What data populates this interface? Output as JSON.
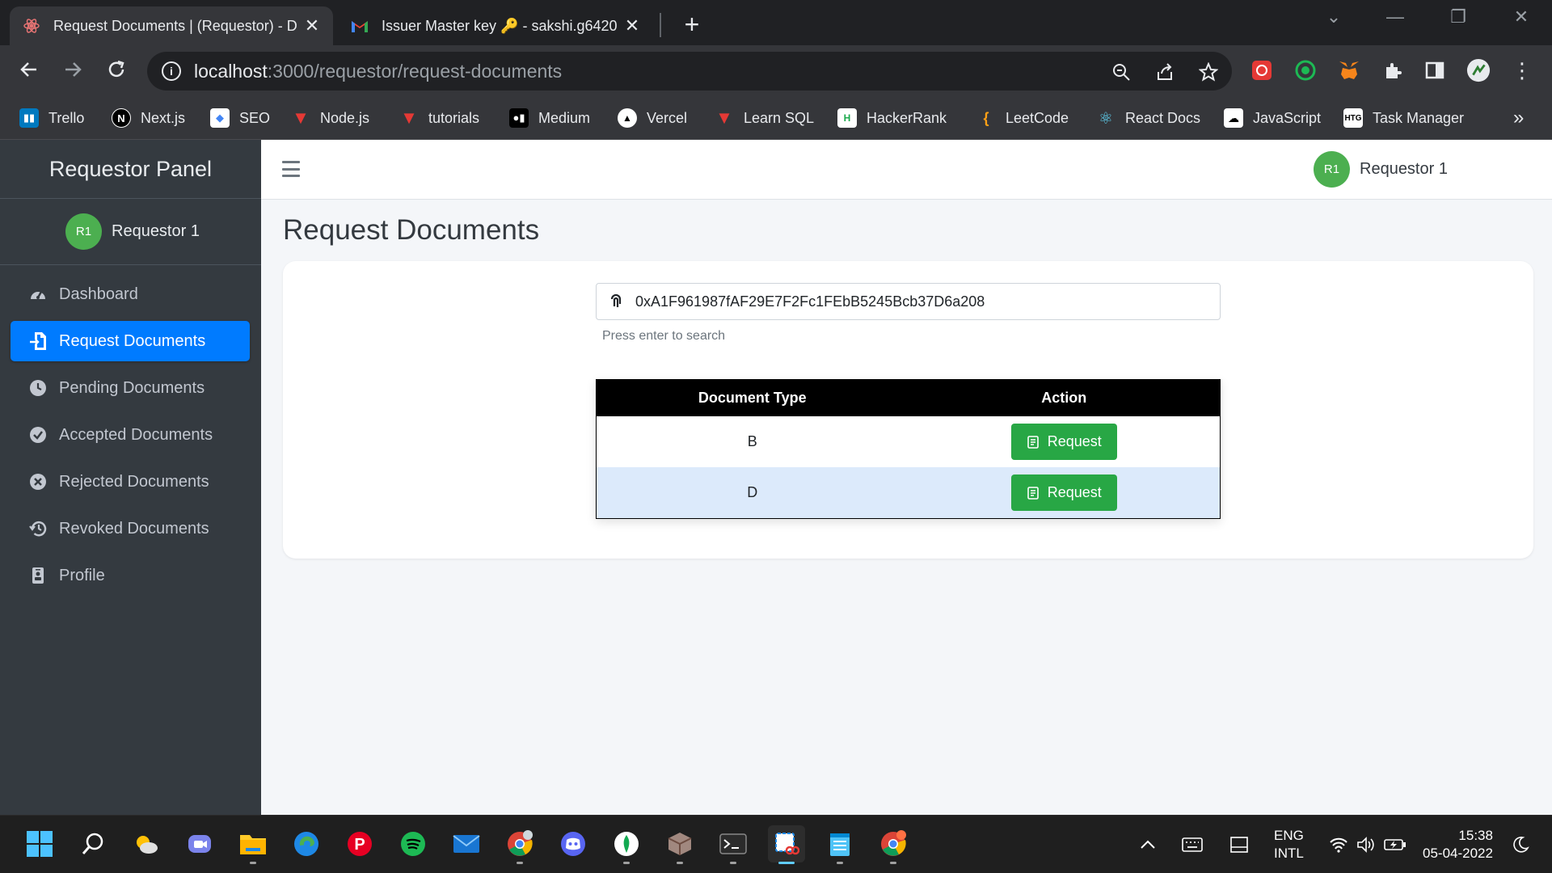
{
  "browser": {
    "tabs": [
      {
        "title": "Request Documents | (Requestor) - D",
        "active": true
      },
      {
        "title": "Issuer Master key 🔑 - sakshi.g6420",
        "active": false
      }
    ],
    "url_host": "localhost",
    "url_path": ":3000/requestor/request-documents",
    "bookmarks": [
      {
        "label": "Trello",
        "icon": "trello-icon",
        "color": "#0079bf"
      },
      {
        "label": "Next.js",
        "icon": "nextjs-icon",
        "color": "#000000"
      },
      {
        "label": "SEO",
        "icon": "seo-icon",
        "color": "#ffffff"
      },
      {
        "label": "Node.js",
        "icon": "vercel-red-icon",
        "color": "#e53935"
      },
      {
        "label": "tutorials",
        "icon": "vercel-red-icon",
        "color": "#e53935"
      },
      {
        "label": "Medium",
        "icon": "medium-icon",
        "color": "#000000"
      },
      {
        "label": "Vercel",
        "icon": "vercel-icon",
        "color": "#000000"
      },
      {
        "label": "Learn SQL",
        "icon": "vercel-red-icon",
        "color": "#e53935"
      },
      {
        "label": "HackerRank",
        "icon": "hackerrank-icon",
        "color": "#1ba94c"
      },
      {
        "label": "LeetCode",
        "icon": "leetcode-icon",
        "color": "#ffa116"
      },
      {
        "label": "React Docs",
        "icon": "react-icon",
        "color": "#61dafb"
      },
      {
        "label": "JavaScript",
        "icon": "javascript-icon",
        "color": "#000000"
      },
      {
        "label": "Task Manager",
        "icon": "htg-icon",
        "color": "#000000"
      }
    ],
    "more_bookmarks": "»"
  },
  "sidebar": {
    "brand": "Requestor Panel",
    "avatar_initials": "R1",
    "user_name": "Requestor 1",
    "items": [
      {
        "label": "Dashboard",
        "icon": "dashboard-icon",
        "active": false
      },
      {
        "label": "Request Documents",
        "icon": "file-import-icon",
        "active": true
      },
      {
        "label": "Pending Documents",
        "icon": "clock-icon",
        "active": false
      },
      {
        "label": "Accepted Documents",
        "icon": "check-circle-icon",
        "active": false
      },
      {
        "label": "Rejected Documents",
        "icon": "times-circle-icon",
        "active": false
      },
      {
        "label": "Revoked Documents",
        "icon": "history-icon",
        "active": false
      },
      {
        "label": "Profile",
        "icon": "id-badge-icon",
        "active": false
      }
    ]
  },
  "header": {
    "avatar_initials": "R1",
    "user_name": "Requestor 1"
  },
  "main": {
    "title": "Request Documents",
    "search_value": "0xA1F961987fAF29E7F2Fc1FEbB5245Bcb37D6a208",
    "search_hint": "Press enter to search",
    "table": {
      "headers": [
        "Document Type",
        "Action"
      ],
      "rows": [
        {
          "type": "B",
          "action": "Request"
        },
        {
          "type": "D",
          "action": "Request"
        }
      ]
    }
  },
  "taskbar": {
    "lang_top": "ENG",
    "lang_bottom": "INTL",
    "time": "15:38",
    "date": "05-04-2022"
  },
  "colors": {
    "sidebar_bg": "#343a40",
    "active_nav": "#007bff",
    "request_button": "#28a745",
    "avatar": "#4caf50",
    "row_alt": "#dceafb"
  }
}
